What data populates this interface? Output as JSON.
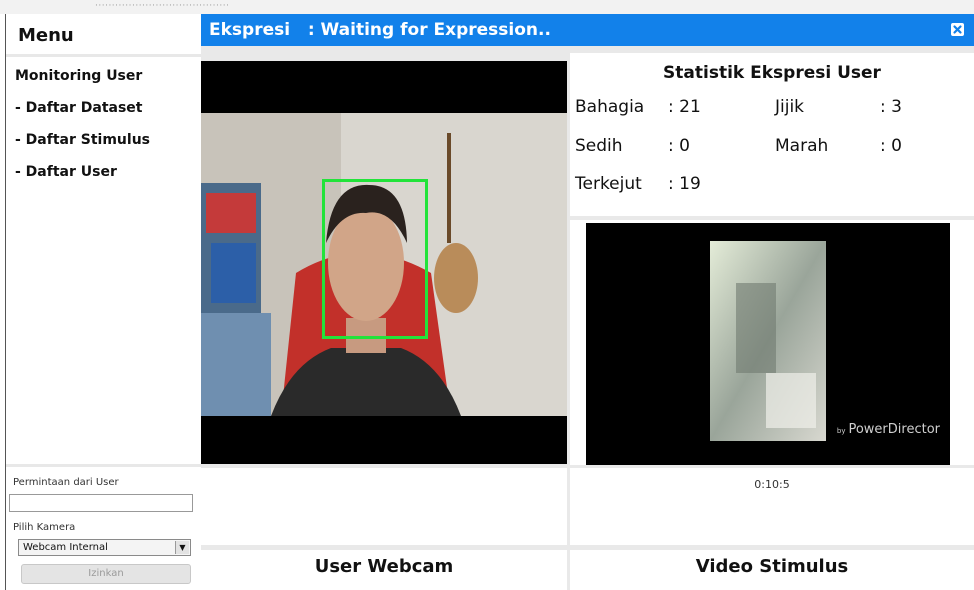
{
  "sidebar": {
    "title": "Menu",
    "items": [
      {
        "label": "Monitoring User"
      },
      {
        "label": "- Daftar Dataset"
      },
      {
        "label": "- Daftar Stimulus"
      },
      {
        "label": "- Daftar User"
      }
    ],
    "request_label": "Permintaan dari User",
    "request_value": "",
    "camera_label": "Pilih Kamera",
    "camera_selected": "Webcam Internal",
    "allow_button": "Izinkan"
  },
  "header": {
    "title": "Ekspresi   : Waiting for Expression..",
    "color": "#1281ea",
    "close_icon": "close-icon"
  },
  "stats": {
    "title": "Statistik Ekspresi User",
    "rows": [
      {
        "label": "Bahagia",
        "value": ": 21"
      },
      {
        "label": "Jijik",
        "value": ": 3"
      },
      {
        "label": "Sedih",
        "value": ": 0"
      },
      {
        "label": "Marah",
        "value": ": 0"
      },
      {
        "label": "Terkejut",
        "value": ": 19"
      }
    ]
  },
  "stimulus": {
    "watermark_prefix": "by",
    "watermark": "PowerDirector",
    "timer": "0:10:5"
  },
  "labels": {
    "webcam": "User Webcam",
    "stimulus": "Video Stimulus"
  },
  "face_box_color": "#22e33a"
}
